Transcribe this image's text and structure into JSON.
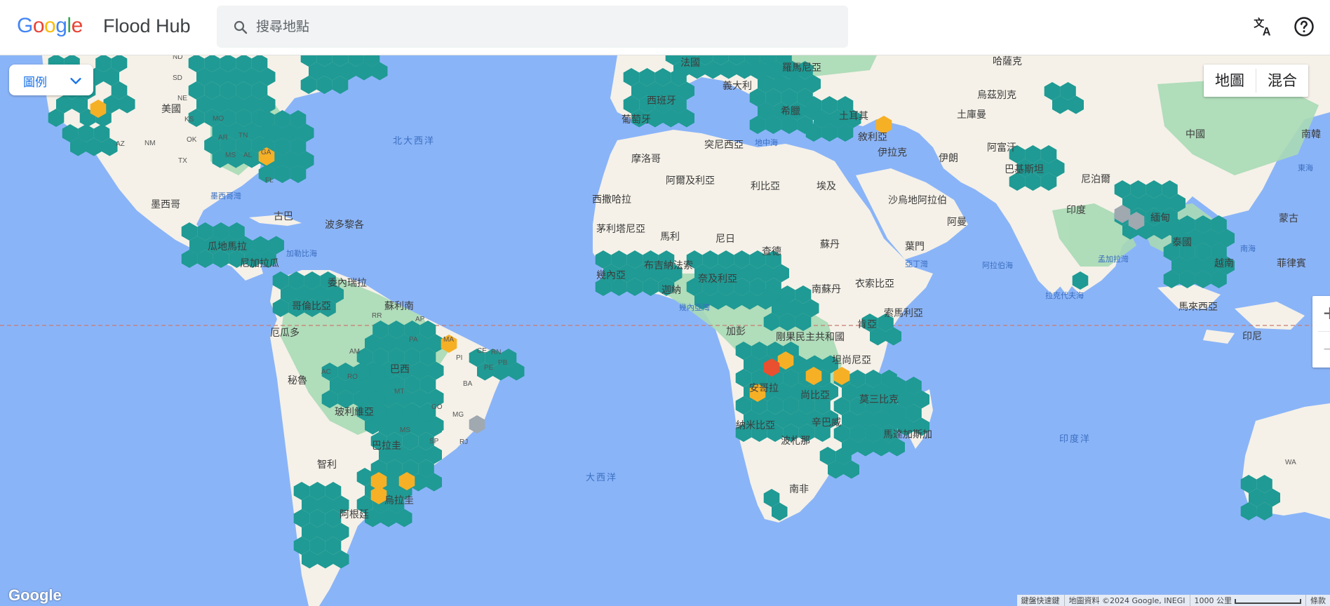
{
  "header": {
    "logo_text": "Google",
    "product": "Flood Hub",
    "search_placeholder": "搜尋地點",
    "translate_icon": "translate-icon",
    "help_icon": "help-icon"
  },
  "legend": {
    "label": "圖例",
    "icon": "chevron-down-icon"
  },
  "map_type": {
    "map": "地圖",
    "hybrid": "混合"
  },
  "zoom": {
    "in": "+",
    "out": "−"
  },
  "footer": {
    "shortcuts": "鍵盤快速鍵",
    "attribution": "地圖資料 ©2024 Google, INEGI",
    "scale": "1000 公里",
    "terms": "條款"
  },
  "colors": {
    "ocean": "#8ab4f8",
    "land": "#f5f1e8",
    "vegetation": "#a8dab5",
    "gauge_teal": "#1f9a94",
    "warning_orange": "#f6b026",
    "danger_red": "#e8502f",
    "nodata_gray": "#a0a8b0"
  },
  "map_labels": {
    "countries": [
      "美國",
      "墨西哥",
      "古巴",
      "波多黎各",
      "瓜地馬拉",
      "尼加拉瓜",
      "委內瑞拉",
      "哥倫比亞",
      "蘇利南",
      "厄瓜多",
      "秘魯",
      "巴西",
      "玻利維亞",
      "巴拉圭",
      "智利",
      "阿根廷",
      "烏拉圭",
      "法國",
      "義大利",
      "西班牙",
      "葡萄牙",
      "希臘",
      "土耳其",
      "烏茲別克",
      "土庫曼",
      "敘利亞",
      "伊拉克",
      "伊朗",
      "阿富汗",
      "巴基斯坦",
      "印度",
      "尼泊爾",
      "中國",
      "南韓",
      "緬甸",
      "泰國",
      "越南",
      "菲律賓",
      "馬來西亞",
      "印尼",
      "摩洛哥",
      "突尼西亞",
      "阿爾及利亞",
      "利比亞",
      "埃及",
      "西撒哈拉",
      "茅利塔尼亞",
      "馬利",
      "尼日",
      "查德",
      "蘇丹",
      "沙烏地阿拉伯",
      "阿曼",
      "葉門",
      "衣索比亞",
      "索馬利亞",
      "南蘇丹",
      "布吉納法索",
      "幾內亞",
      "迦納",
      "奈及利亞",
      "加彭",
      "剛果民主共和國",
      "肯亞",
      "坦尚尼亞",
      "安哥拉",
      "尚比亞",
      "莫三比克",
      "辛巴威",
      "納米比亞",
      "波札那",
      "南非",
      "馬達加斯加",
      "哈薩克",
      "蒙古",
      "羅馬尼亞"
    ],
    "water": [
      "北大西洋",
      "墨西哥灣",
      "加勒比海",
      "大西洋",
      "地中海",
      "亞丁灣",
      "阿拉伯海",
      "孟加拉灣",
      "拉克代夫海",
      "南海",
      "東海",
      "印度洋",
      "幾內亞灣"
    ],
    "us_states": [
      "ND",
      "SD",
      "NE",
      "KS",
      "OK",
      "TX",
      "NM",
      "AZ",
      "MO",
      "AR",
      "MS",
      "AL",
      "TN",
      "GA",
      "FL"
    ],
    "brazil_states": [
      "AM",
      "AC",
      "RO",
      "MT",
      "MS",
      "SP",
      "RJ",
      "MG",
      "BA",
      "PE",
      "PB",
      "RN",
      "CE",
      "PI",
      "MA",
      "PA",
      "AP",
      "RR",
      "GO"
    ],
    "australia": [
      "WA"
    ]
  },
  "gauges": {
    "description": "hexagonal forecast gauge cells",
    "statuses": [
      "no-alert",
      "warning",
      "danger",
      "no-data"
    ]
  }
}
